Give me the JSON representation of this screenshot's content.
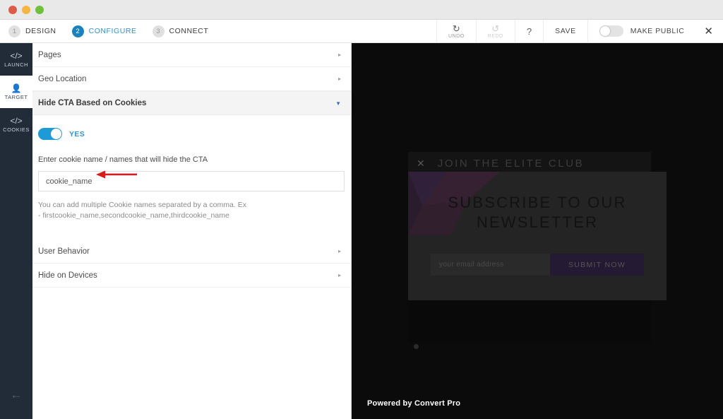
{
  "window": {
    "lights": [
      "close",
      "minimize",
      "zoom"
    ]
  },
  "wizard": {
    "steps": [
      {
        "num": "1",
        "label": "DESIGN",
        "active": false
      },
      {
        "num": "2",
        "label": "CONFIGURE",
        "active": true
      },
      {
        "num": "3",
        "label": "CONNECT",
        "active": false
      }
    ]
  },
  "toolbar": {
    "undo_label": "UNDO",
    "redo_label": "REDO",
    "help_label": "?",
    "save_label": "SAVE",
    "make_public_label": "MAKE PUBLIC",
    "make_public_state": "off",
    "close_label": "✕"
  },
  "rail": {
    "items": [
      {
        "label": "LAUNCH",
        "icon": "code-icon",
        "active": false
      },
      {
        "label": "TARGET",
        "icon": "person-icon",
        "active": true
      },
      {
        "label": "COOKIES",
        "icon": "code-icon",
        "active": false
      }
    ],
    "back_label": "←"
  },
  "panel": {
    "rows_top": [
      {
        "label": "Pages",
        "chevron": "▸"
      },
      {
        "label": "Geo Location",
        "chevron": "▸"
      }
    ],
    "open_row": {
      "label": "Hide CTA Based on Cookies",
      "chevron": "▼"
    },
    "toggle": {
      "state": "on",
      "label": "YES"
    },
    "field_label": "Enter cookie name / names that will hide the CTA",
    "input_placeholder": "cookie_name",
    "input_value": "",
    "help_text": "You can add multiple Cookie names separated by a comma. Ex - firstcookie_name,secondcookie_name,thirdcookie_name",
    "rows_bottom": [
      {
        "label": "User Behavior",
        "chevron": "▸"
      },
      {
        "label": "Hide on Devices",
        "chevron": "▸"
      }
    ]
  },
  "annotation": {
    "arrow_color": "#d41e1e",
    "direction": "left"
  },
  "preview": {
    "bar_title": "JOIN THE ELITE CLUB",
    "bar_close": "✕",
    "heading_line1": "SUBSCRIBE TO OUR",
    "heading_line2": "NEWSLETTER",
    "email_placeholder": "your email address",
    "submit_label": "SUBMIT NOW",
    "footer": "Powered by Convert Pro"
  },
  "colors": {
    "accent_blue": "#1e9ad6",
    "step_active": "#1b82bd",
    "rail_bg": "#222b38",
    "preview_bg": "#0b0b0b",
    "submit_bg": "#251a33",
    "annotation_red": "#d41e1e"
  }
}
